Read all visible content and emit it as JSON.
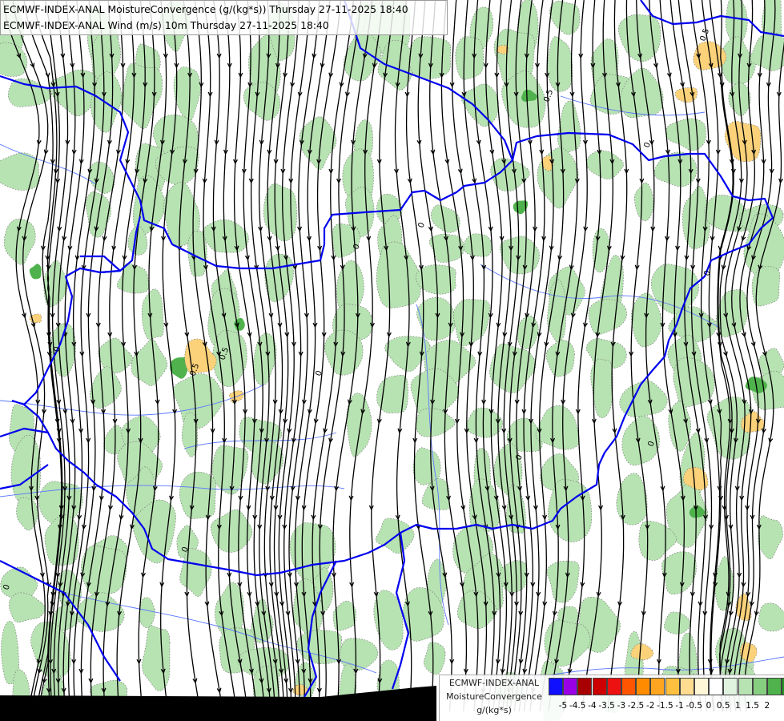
{
  "header": {
    "line1": "ECMWF-INDEX-ANAL MoistureConvergence (g/(kg*s)) Thursday 27-11-2025 18:40",
    "line2": "ECMWF-INDEX-ANAL Wind (m/s) 10m Thursday 27-11-2025 18:40"
  },
  "legend": {
    "model": "ECMWF-INDEX-ANAL",
    "parameter": "MoistureConvergence",
    "unit": "g/(kg*s)",
    "colors": [
      "#1010ff",
      "#9a00e6",
      "#a80000",
      "#cc0000",
      "#ee1111",
      "#ff5500",
      "#ff8c00",
      "#ffa520",
      "#ffc040",
      "#ffdc90",
      "#fff6d8",
      "#ffffff",
      "#dff3df",
      "#b7e2b2",
      "#86cf80",
      "#4fb24c",
      "#229a22"
    ],
    "ticks": [
      "-5",
      "-4.5",
      "-4",
      "-3.5",
      "-3",
      "-2.5",
      "-2",
      "-1.5",
      "-1",
      "-0.5",
      "0",
      "0.5",
      "1",
      "1.5",
      "2"
    ]
  },
  "contour_labels": [
    "0.5",
    "0.5",
    "0.5",
    "0.5",
    "0",
    "0",
    "0",
    "0",
    "0",
    "0",
    "0",
    "0",
    "0",
    "0"
  ],
  "palette": {
    "border": "#0000ee",
    "river": "#5a78ff",
    "streamline": "#000000",
    "positive_fill": "#b7e2b2",
    "strong_positive_fill": "#4fb24c",
    "negative_fill": "#fbd27a"
  }
}
